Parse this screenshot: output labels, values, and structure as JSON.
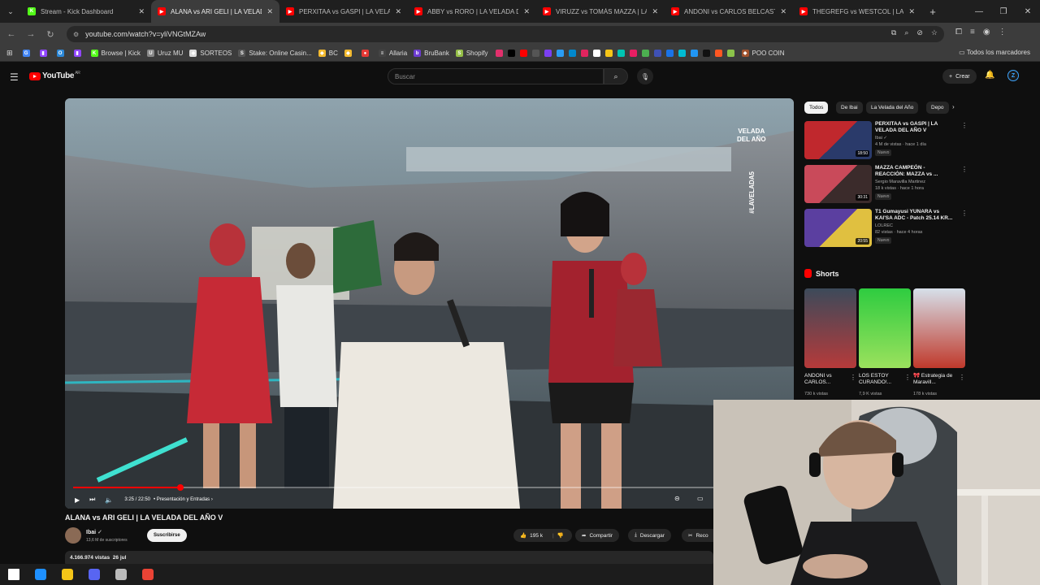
{
  "tabs": [
    {
      "title": "Stream - Kick Dashboard",
      "favicon_color": "#53fc18",
      "favicon_letter": "K",
      "active": false
    },
    {
      "title": "ALANA vs ARI GELI | LA VELADA",
      "favicon_color": "#ff0000",
      "favicon_letter": "▶",
      "active": true
    },
    {
      "title": "PERXITAA vs GASPI | LA VELADA",
      "favicon_color": "#ff0000",
      "favicon_letter": "▶",
      "active": false
    },
    {
      "title": "ABBY vs RORO | LA VELADA DE",
      "favicon_color": "#ff0000",
      "favicon_letter": "▶",
      "active": false
    },
    {
      "title": "VIRUZZ vs TOMÁS MAZZA | LA",
      "favicon_color": "#ff0000",
      "favicon_letter": "▶",
      "active": false
    },
    {
      "title": "ANDONI vs CARLOS BELCAST",
      "favicon_color": "#ff0000",
      "favicon_letter": "▶",
      "active": false
    },
    {
      "title": "THEGREFG vs WESTCOL | LA VE",
      "favicon_color": "#ff0000",
      "favicon_letter": "▶",
      "active": false
    }
  ],
  "address": {
    "url": "youtube.com/watch?v=yliVNGtMZAw"
  },
  "bookmarks": [
    {
      "label": "",
      "color": "#4285f4",
      "letter": "G"
    },
    {
      "label": "",
      "color": "#9146ff",
      "letter": "▮"
    },
    {
      "label": "",
      "color": "#2b88d8",
      "letter": "O"
    },
    {
      "label": "",
      "color": "#9146ff",
      "letter": "▮"
    },
    {
      "label": "Browse | Kick",
      "color": "#53fc18",
      "letter": "K"
    },
    {
      "label": "Uruz MU",
      "color": "#888888",
      "letter": "U"
    },
    {
      "label": "SORTEOS",
      "color": "#dddddd",
      "letter": "◆"
    },
    {
      "label": "Stake: Online Casin...",
      "color": "#555555",
      "letter": "S"
    },
    {
      "label": "BC",
      "color": "#f3ba2f",
      "letter": "◆"
    },
    {
      "label": "",
      "color": "#f3ba2f",
      "letter": "◆"
    },
    {
      "label": "",
      "color": "#e53935",
      "letter": "●"
    },
    {
      "label": "Allaria",
      "color": "#444444",
      "letter": "≡"
    },
    {
      "label": "BruBank",
      "color": "#6c3bd1",
      "letter": "b"
    },
    {
      "label": "Shopify",
      "color": "#95bf47",
      "letter": "S"
    }
  ],
  "bookmark_icons": [
    "#e1306c",
    "#000000",
    "#ff0000",
    "#555555",
    "#7b3ff2",
    "#2a9df4",
    "#0088cc",
    "#e0245e",
    "#ffffff",
    "#f5c518",
    "#00c4b3",
    "#e91e63",
    "#4caf50",
    "#3f51b5",
    "#1a73e8",
    "#00bcd4",
    "#2196f3",
    "#111111",
    "#ff5722",
    "#8bc34a"
  ],
  "bookmark_last": "POO COIN",
  "all_bookmarks": "Todos los marcadores",
  "youtube": {
    "logo": "YouTube",
    "region": "AR",
    "search_placeholder": "Buscar",
    "create_label": "Crear"
  },
  "video": {
    "title": "ALANA vs ARI GELI | LA VELADA DEL AÑO V",
    "time": "3:25 / 22:50",
    "chapter": "• Presentación y Entradas",
    "progress": 0.15,
    "watermark_line1": "VELADA",
    "watermark_line2": "DEL AÑO",
    "hashtag": "#LAVELADA5",
    "channel": "Ibai",
    "subscribers": "13,6 M de suscriptores",
    "subscribe_label": "Suscribirse",
    "likes": "195 k",
    "share_label": "Compartir",
    "download_label": "Descargar",
    "clip_label": "Reco",
    "views": "4.166.974 vistas",
    "date": "26 jul"
  },
  "chips": [
    {
      "label": "Todos",
      "selected": true
    },
    {
      "label": "De Ibai",
      "selected": false
    },
    {
      "label": "La Velada del Año",
      "selected": false
    },
    {
      "label": "Depo",
      "selected": false
    }
  ],
  "recommended": [
    {
      "title": "PERXITAA vs GASPI | LA VELADA DEL AÑO V",
      "channel": "Ibai ✓",
      "meta": "4 M de vistas · hace 1 día",
      "badge": "Nuevo",
      "duration": "18:50",
      "thumb_a": "#c0282d",
      "thumb_b": "#2a3a6a"
    },
    {
      "title": "MAZZA CAMPEÓN - REACCIÓN: MAZZA vs ...",
      "channel": "Sergio Maravilla Martinez",
      "meta": "18 k vistas · hace 1 hora",
      "badge": "Nuevo",
      "duration": "30:31",
      "thumb_a": "#c94a5a",
      "thumb_b": "#3b2b2b"
    },
    {
      "title": "T1 Gumayusi YUNARA vs KAI'SA ADC - Patch 25.14 KR...",
      "channel": "LOLREC",
      "meta": "82 vistas · hace 4 horas",
      "badge": "Nuevo",
      "duration": "20:55",
      "thumb_a": "#5b3fa0",
      "thumb_b": "#e0c040"
    }
  ],
  "shorts_label": "Shorts",
  "shorts": [
    {
      "title": "ANDONI vs CARLOS...",
      "views": "730 k vistas",
      "color_a": "#3c4a5a",
      "color_b": "#b63a3a"
    },
    {
      "title": "LOS ESTOY CURANDO!...",
      "views": "7,9 K vistas",
      "color_a": "#2ecc40",
      "color_b": "#9be15d"
    },
    {
      "title": "🎀 Estrategia de Maravill...",
      "views": "178 k vistas",
      "color_a": "#d6e0ea",
      "color_b": "#c0392b"
    }
  ],
  "taskbar": [
    "#ffffff",
    "#1e90ff",
    "#f5c518",
    "#5865f2",
    "#bbbbbb",
    "#ea4335"
  ]
}
